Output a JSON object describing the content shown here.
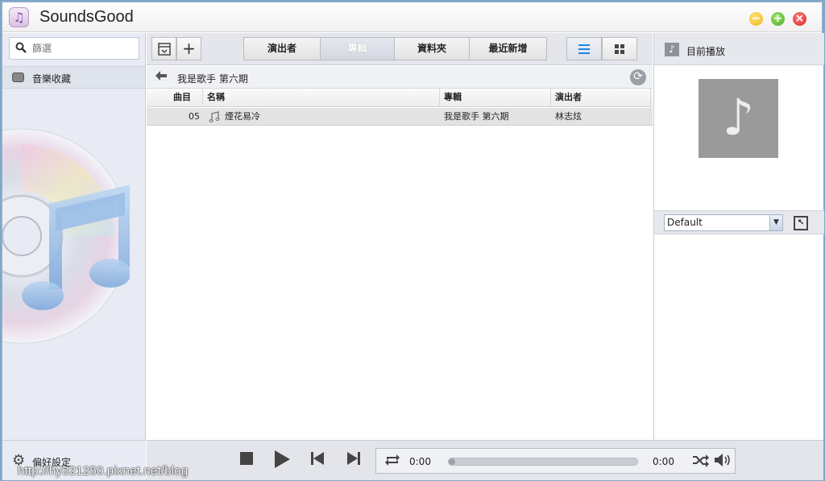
{
  "app": {
    "title": "SoundsGood",
    "icon": "music-note-icon"
  },
  "window_controls": {
    "minimize": "−",
    "maximize": "+",
    "close": "×"
  },
  "sidebar": {
    "search": {
      "placeholder": "篩選",
      "value": ""
    },
    "library_label": "音樂收藏",
    "preferences_label": "偏好設定"
  },
  "toolbar": {
    "tabs": [
      {
        "label": "演出者",
        "active": false
      },
      {
        "label": "專輯",
        "active": true
      },
      {
        "label": "資料夾",
        "active": false
      },
      {
        "label": "最近新增",
        "active": false
      }
    ]
  },
  "breadcrumb": {
    "label": "我是歌手 第六期"
  },
  "table": {
    "columns": [
      "曲目",
      "名稱",
      "專輯",
      "演出者"
    ],
    "rows": [
      {
        "track": "05",
        "name": "煙花易冷",
        "album": "我是歌手 第六期",
        "artist": "林志炫"
      }
    ]
  },
  "now_playing": {
    "header": "目前播放",
    "preset": "Default"
  },
  "player": {
    "time_current": "0:00",
    "time_total": "0:00",
    "progress": 0
  },
  "watermark": "http://hy321250.pixnet.net/blog",
  "colors": {
    "accent_blue": "#1e88e5",
    "close_red": "#d92424",
    "min_yellow": "#f0b11a",
    "max_green": "#4aa92a"
  }
}
